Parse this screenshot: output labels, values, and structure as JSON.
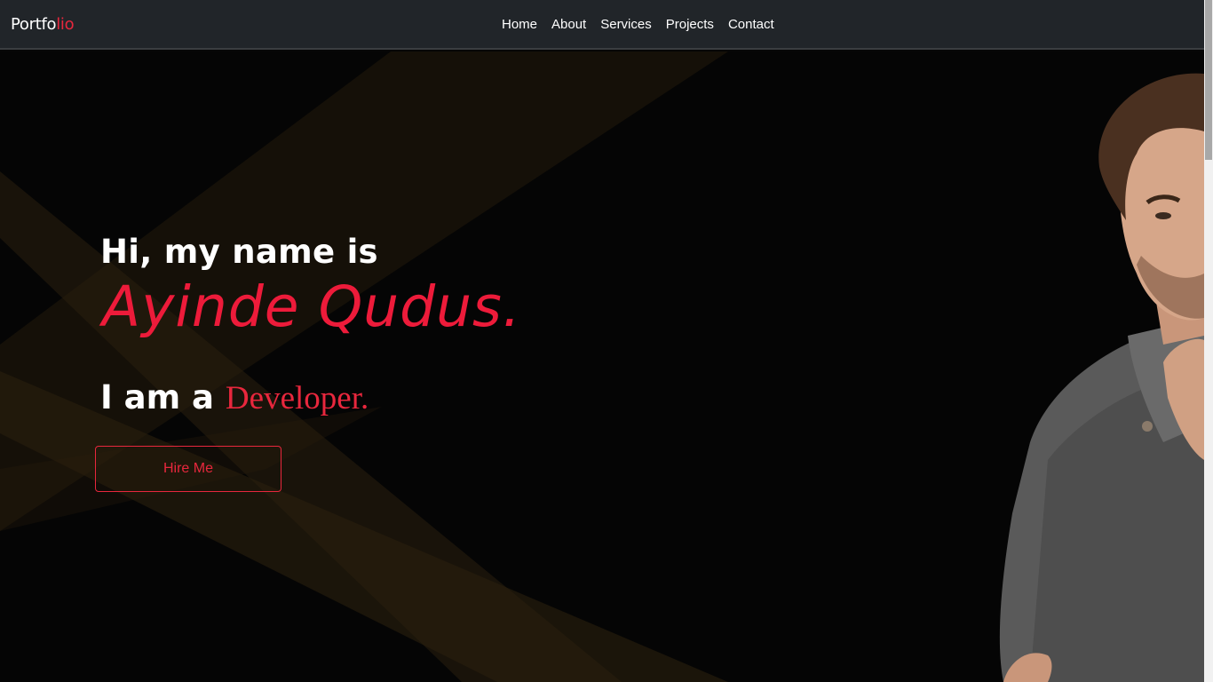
{
  "navbar": {
    "brand_main": "Portfo",
    "brand_accent": "lio",
    "links": [
      "Home",
      "About",
      "Services",
      "Projects",
      "Contact"
    ]
  },
  "hero": {
    "greeting": "Hi, my name is",
    "name": "Ayinde Qudus.",
    "role_prefix": "I am a",
    "role_typed": "Developer.",
    "cta_label": "Hire Me"
  },
  "colors": {
    "accent": "#e8273d",
    "navbar_bg": "#212529",
    "hero_bg": "#050505",
    "beam": "#3a2a10"
  }
}
